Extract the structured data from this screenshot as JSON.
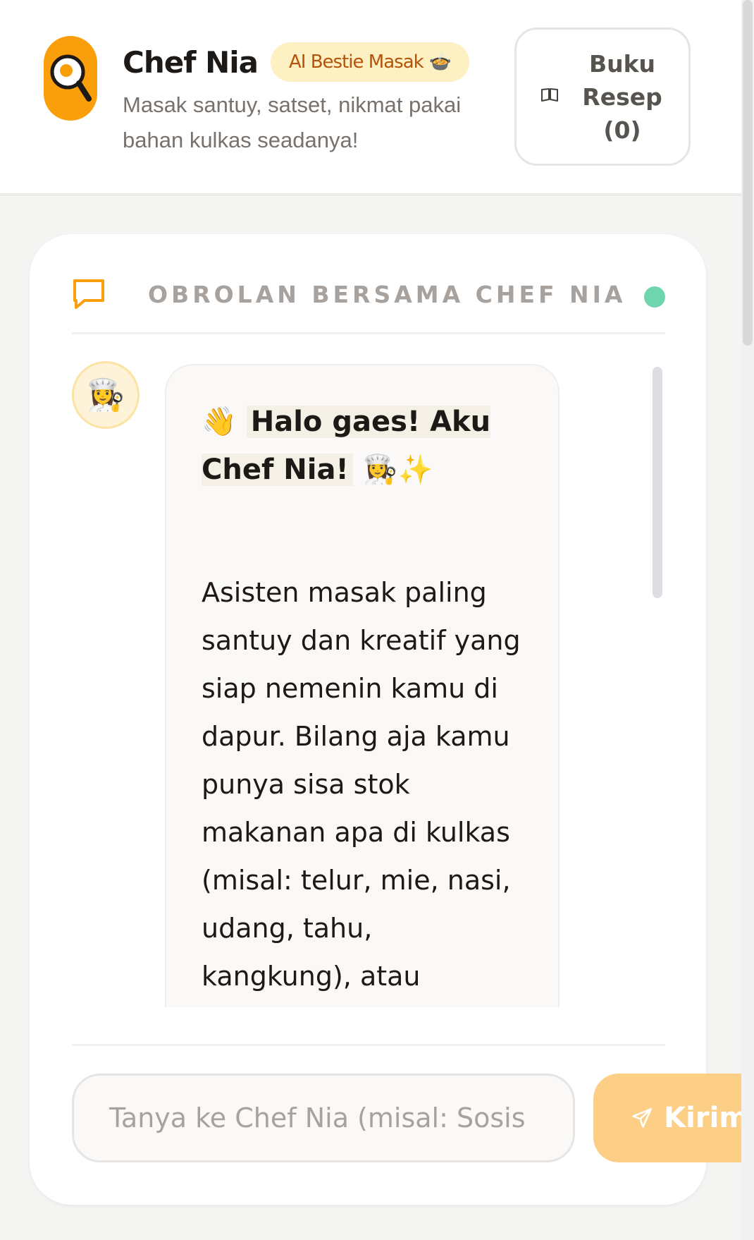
{
  "header": {
    "logo_icon": "frying-pan-egg-icon",
    "title": "Chef Nia",
    "badge_label": "AI Bestie Masak",
    "badge_emoji": "🍲",
    "subtitle": "Masak santuy, satset, nikmat pakai bahan kulkas seadanya!",
    "recipe_book_label": "Buku Resep (0)",
    "recipe_book_icon": "open-book-icon"
  },
  "chat": {
    "title": "OBROLAN BERSAMA CHEF NIA",
    "title_icon": "chat-bubble-icon",
    "status_color": "#6ed5ae",
    "messages": [
      {
        "sender": "bot",
        "avatar": "👩‍🍳",
        "greeting_wave": "👋",
        "greeting": "Halo gaes! Aku Chef Nia!",
        "greeting_emoji": "👩‍🍳✨",
        "body": "Asisten masak paling santuy dan kreatif yang siap nemenin kamu di dapur. Bilang aja kamu punya sisa stok makanan apa di kulkas (misal: telur, mie, nasi, udang, tahu, kangkung), atau"
      }
    ],
    "input_placeholder": "Tanya ke Chef Nia (misal: Sosis",
    "send_label": "Kirim",
    "send_icon": "paper-plane-icon"
  },
  "colors": {
    "accent": "#fb9e0b",
    "badge_bg": "#fdf0c2",
    "badge_text": "#b45309",
    "send_bg": "#fdcf86"
  }
}
